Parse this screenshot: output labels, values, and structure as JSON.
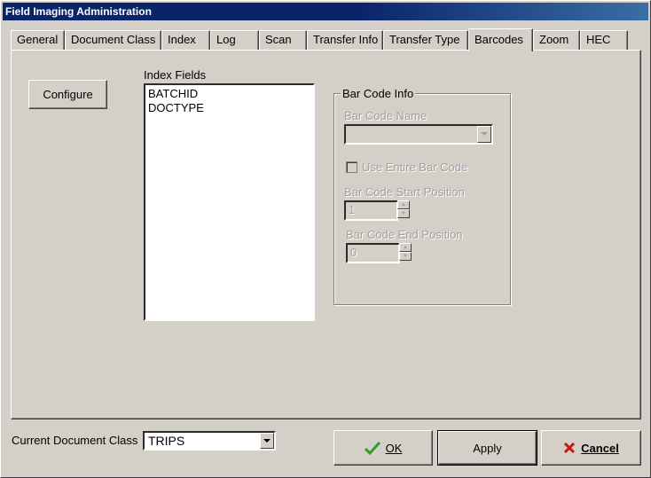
{
  "window": {
    "title": "Field Imaging Administration"
  },
  "tabs": [
    {
      "label": "General",
      "active": false
    },
    {
      "label": "Document Class",
      "active": false
    },
    {
      "label": "Index",
      "active": false
    },
    {
      "label": "Log",
      "active": false
    },
    {
      "label": "Scan",
      "active": false
    },
    {
      "label": "Transfer Info",
      "active": false
    },
    {
      "label": "Transfer Type",
      "active": false
    },
    {
      "label": "Barcodes",
      "active": true
    },
    {
      "label": "Zoom",
      "active": false
    },
    {
      "label": "HEC",
      "active": false
    }
  ],
  "barcodes": {
    "configure_label": "Configure",
    "index_fields_label": "Index Fields",
    "index_fields": [
      "BATCHID",
      "DOCTYPE"
    ],
    "group_title": "Bar Code Info",
    "bar_code_name_label": "Bar Code Name",
    "bar_code_name_value": "",
    "use_entire_label": "Use Entire Bar Code",
    "use_entire_checked": false,
    "start_position_label": "Bar Code Start Position",
    "start_position_value": "1",
    "end_position_label": "Bar Code End Position",
    "end_position_value": "0"
  },
  "footer": {
    "current_doc_class_label": "Current Document Class",
    "current_doc_class_value": "TRIPS",
    "ok_label": "OK",
    "apply_label": "Apply",
    "cancel_label": "Cancel"
  },
  "colors": {
    "title_bar": "#0a246a",
    "ok_check": "#2e9e2e",
    "cancel_x": "#c01818"
  }
}
